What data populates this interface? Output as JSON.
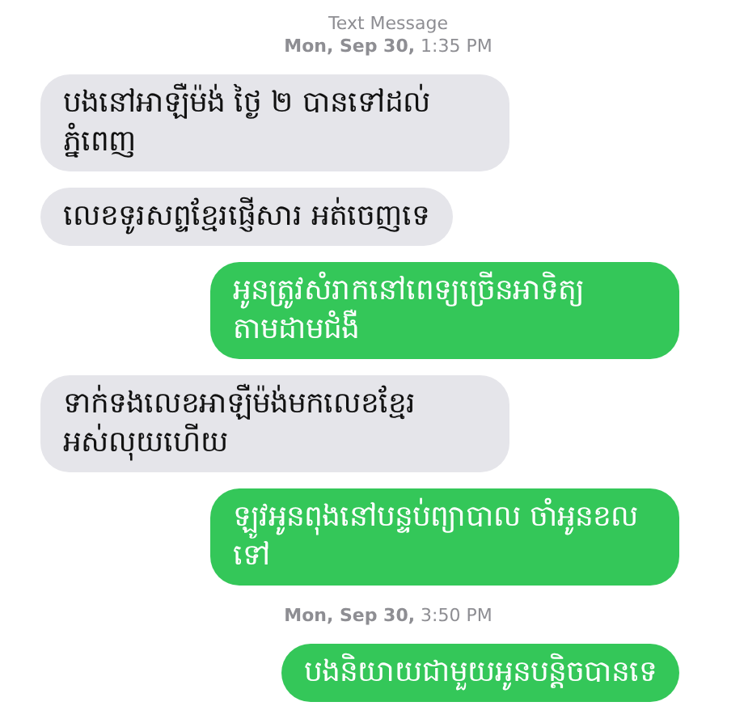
{
  "header": {
    "label": "Text Message",
    "timestamp": "**Mon, Sep 30,** 1:35 PM"
  },
  "messages": [
    {
      "kind": "incoming",
      "text": "បងនៅអាឡឺម៉ង់ ថ្ងៃ ២ បានទៅដល់ភ្នំពេញ"
    },
    {
      "kind": "incoming",
      "text": "លេខទូរសព្ទខ្មែរផ្ញើសារ អត់ចេញទេ"
    },
    {
      "kind": "outgoing",
      "text": "អូនត្រូវសំរាកនៅពេទ្យច្រើនអាទិត្យ តាមដាមជំងឺ"
    },
    {
      "kind": "incoming",
      "text": "ទាក់ទងលេខអាឡឺម៉ង់មកលេខខ្មែរអស់លុយហើយ"
    },
    {
      "kind": "outgoing",
      "text": "ឡូវអូនពុងនៅបន្ទប់ព្យាបាល ចាំអូនខលទៅ"
    },
    {
      "kind": "timestamp",
      "text": "**Mon, Sep 30,** 3:50 PM"
    },
    {
      "kind": "outgoing",
      "text": "បងនិយាយជាមួយអូនបន្តិចបានទេ"
    }
  ]
}
